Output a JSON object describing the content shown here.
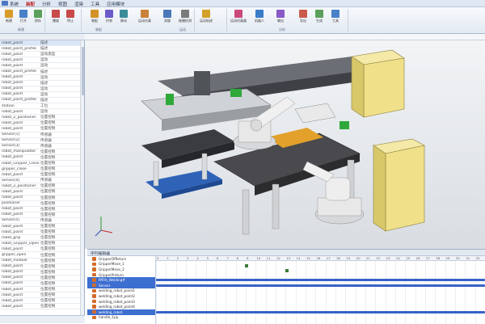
{
  "menu": [
    "系统",
    "装配",
    "分析",
    "视图",
    "渲染",
    "工具",
    "应用模块"
  ],
  "ribbon_groups": [
    {
      "label": "新建"
    },
    {
      "label": "装配"
    },
    {
      "label": "运动"
    },
    {
      "label": "分析"
    }
  ],
  "ribbon_buttons": [
    {
      "label": "新建",
      "color": "#d89b2a"
    },
    {
      "label": "打开",
      "color": "#4a80c8"
    },
    {
      "label": "保存",
      "color": "#5aa05a"
    },
    {
      "label": "播放",
      "color": "#c94a4a"
    },
    {
      "label": "停止",
      "color": "#c94a4a"
    },
    {
      "label": "装配",
      "color": "#d4912a"
    },
    {
      "label": "约束",
      "color": "#6b5bc9"
    },
    {
      "label": "移动",
      "color": "#3a8c9a"
    },
    {
      "label": "运动仿真",
      "color": "#c9823a"
    },
    {
      "label": "测量",
      "color": "#4a7ab8"
    },
    {
      "label": "碰撞检测",
      "color": "#7a7a7a"
    },
    {
      "label": "运动轨迹",
      "color": "#d4a02a"
    },
    {
      "label": "运动仿真器",
      "color": "#c94a7a"
    },
    {
      "label": "机器人",
      "color": "#3a7cc8"
    },
    {
      "label": "输出",
      "color": "#8a5ac8"
    },
    {
      "label": "导出",
      "color": "#c95a4a"
    },
    {
      "label": "生成",
      "color": "#5aa05a"
    },
    {
      "label": "工具",
      "color": "#4a80c8"
    }
  ],
  "panel_rows": [
    {
      "name": "robot_point",
      "value": "描述"
    },
    {
      "name": "robot_point_profile",
      "value": "描述"
    },
    {
      "name": "robot_point",
      "value": "运动类型"
    },
    {
      "name": "robot_point",
      "value": "运动"
    },
    {
      "name": "robot_point",
      "value": "运动"
    },
    {
      "name": "robot_point_profile",
      "value": "描述"
    },
    {
      "name": "robot_point",
      "value": "运动"
    },
    {
      "name": "robot_point",
      "value": "描述"
    },
    {
      "name": "robot_point",
      "value": "运动"
    },
    {
      "name": "robot_point",
      "value": "运动"
    },
    {
      "name": "robot_point_profile",
      "value": "描述"
    },
    {
      "name": "station",
      "value": "工位"
    },
    {
      "name": "robot_point",
      "value": "运动"
    },
    {
      "name": "robot_2_positioner",
      "value": "位置控制"
    },
    {
      "name": "robot_point",
      "value": "位置控制"
    },
    {
      "name": "robot_point",
      "value": "位置控制"
    },
    {
      "name": "Sensor[1]",
      "value": "传感器"
    },
    {
      "name": "Sensor[2]",
      "value": "传感器"
    },
    {
      "name": "Sensor[3]",
      "value": "传感器"
    },
    {
      "name": "robot_manipulator",
      "value": "位置控制"
    },
    {
      "name": "robot_point",
      "value": "位置控制"
    },
    {
      "name": "robot_Gripper_Close",
      "value": "位置控制"
    },
    {
      "name": "gripper_close",
      "value": "位置控制"
    },
    {
      "name": "robot_point",
      "value": "位置控制"
    },
    {
      "name": "Sensor[4]",
      "value": "传感器"
    },
    {
      "name": "robot_2_positioner",
      "value": "位置控制"
    },
    {
      "name": "robot_point",
      "value": "位置控制"
    },
    {
      "name": "robot_point",
      "value": "位置控制"
    },
    {
      "name": "positioner",
      "value": "位置控制"
    },
    {
      "name": "robot_point",
      "value": "位置控制"
    },
    {
      "name": "robot_point",
      "value": "位置控制"
    },
    {
      "name": "Sensor[5]",
      "value": "传感器"
    },
    {
      "name": "robot_point",
      "value": "位置控制"
    },
    {
      "name": "robot_point",
      "value": "位置控制"
    },
    {
      "name": "robot_grip",
      "value": "位置控制"
    },
    {
      "name": "robot_Gripper_Open",
      "value": "位置控制"
    },
    {
      "name": "robot_point",
      "value": "位置控制"
    },
    {
      "name": "gripper_open",
      "value": "位置控制"
    },
    {
      "name": "robot_module",
      "value": "位置控制"
    },
    {
      "name": "robot_point",
      "value": "位置控制"
    },
    {
      "name": "robot_point",
      "value": "位置控制"
    },
    {
      "name": "robot_point",
      "value": "位置控制"
    },
    {
      "name": "robot_point",
      "value": "位置控制"
    },
    {
      "name": "robot_point",
      "value": "位置控制"
    },
    {
      "name": "robot_point",
      "value": "位置控制"
    },
    {
      "name": "robot_point",
      "value": "位置控制"
    },
    {
      "name": "robot_point",
      "value": "位置控制"
    }
  ],
  "sequence": {
    "title": "序列编辑器",
    "ticks": [
      "0",
      "1",
      "2",
      "3",
      "4",
      "5",
      "6",
      "7",
      "8",
      "9",
      "10",
      "11",
      "12",
      "13",
      "14",
      "15",
      "16",
      "17",
      "18",
      "19",
      "20",
      "21",
      "22",
      "23",
      "24",
      "25",
      "26",
      "27",
      "28",
      "29",
      "30",
      "31",
      "32"
    ],
    "rows": [
      {
        "label": "GripperOfReturn",
        "selected": false
      },
      {
        "label": "GripperMove_1",
        "selected": false
      },
      {
        "label": "GripperMove_2",
        "selected": false
      },
      {
        "label": "GripperPreturn",
        "selected": false
      },
      {
        "label": "PATH_Welding#",
        "selected": true
      },
      {
        "label": "Sensor",
        "selected": true
      },
      {
        "label": "welding_robot_point1",
        "selected": false
      },
      {
        "label": "welding_robot_point2",
        "selected": false
      },
      {
        "label": "welding_robot_point3",
        "selected": false
      },
      {
        "label": "welding_robot_point4",
        "selected": false
      },
      {
        "label": "welding_robot",
        "selected": true
      },
      {
        "label": "handle_1pp",
        "selected": false
      }
    ]
  },
  "colors": {
    "yellow_cabinet": "#f0e08a",
    "robot_white": "#e8e8e8",
    "table_dark": "#4a4a4e",
    "blue_base": "#2f63b8",
    "orange_part": "#e3a02a",
    "green_part": "#2fa83a",
    "timeline_bar": "#3663c9",
    "selection": "#3d6fd1"
  }
}
